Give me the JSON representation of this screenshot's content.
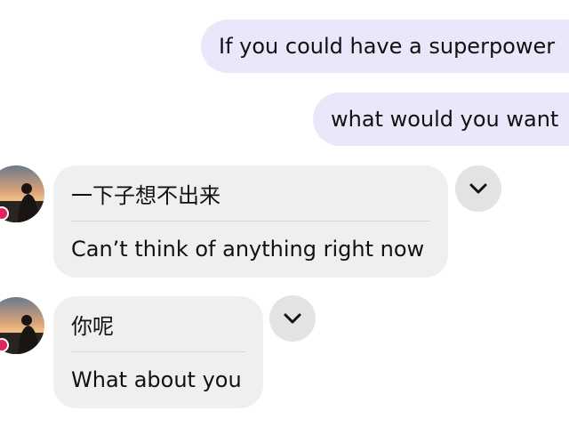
{
  "conversation": {
    "outgoing": [
      {
        "text": "If you could have a superpower"
      },
      {
        "text": "what would you want"
      }
    ],
    "incoming": [
      {
        "original": "一下子想不出来",
        "translation": "Can’t think of anything right now",
        "expand_icon": "chevron-down-icon"
      },
      {
        "original": "你呢",
        "translation": "What about you",
        "expand_icon": "chevron-down-icon"
      }
    ]
  },
  "colors": {
    "outgoing_bubble": "#ebe7fb",
    "incoming_bubble": "#efefef",
    "divider": "#d6d6d6",
    "status_dot": "#e0245e"
  }
}
